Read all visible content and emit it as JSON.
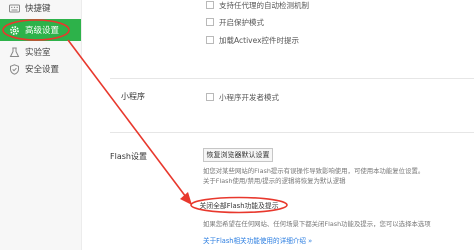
{
  "sidebar": {
    "items": [
      {
        "label": "快捷键",
        "icon": "keyboard-icon"
      },
      {
        "label": "高级设置",
        "icon": "gear-icon"
      },
      {
        "label": "实验室",
        "icon": "flask-icon"
      },
      {
        "label": "安全设置",
        "icon": "shield-icon"
      }
    ],
    "active_index": 1
  },
  "general": {
    "options": [
      {
        "label": "支持任代理的自动检测机制",
        "checked": false
      },
      {
        "label": "开启保护模式",
        "checked": false
      },
      {
        "label": "加载Activex控件时提示",
        "checked": false
      }
    ]
  },
  "mini_program": {
    "title": "小程序",
    "option_label": "小程序开发者模式",
    "checked": false
  },
  "flash": {
    "title": "Flash设置",
    "restore_button": "恢复浏览器默认设置",
    "description_lines": [
      "如您对某些网站的Flash提示有误操作导致影响使用，可使用本功能复位设置。",
      "关于Flash使用/禁用/提示的逻辑将恢复为默认逻辑"
    ],
    "disable_all_button": "关闭全部Flash功能及提示",
    "disable_description_lines": [
      "如果您希望在任何网站、任何场景下都关闭Flash功能及提示，您可以选择本选项"
    ],
    "help_link": "关于Flash相关功能使用的详细介绍 »"
  },
  "colors": {
    "accent": "#2db24a",
    "annotation": "#e8382d",
    "link": "#2a7de1"
  }
}
